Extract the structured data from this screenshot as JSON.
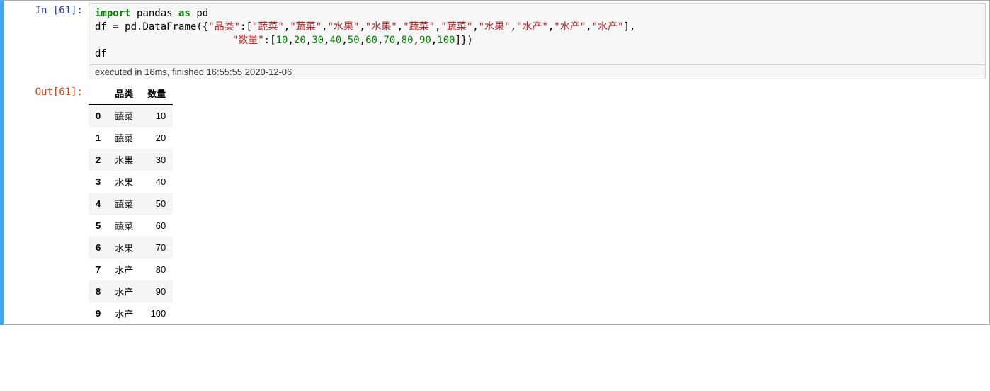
{
  "cell": {
    "in_prompt": "In  [61]:",
    "out_prompt": "Out[61]:",
    "exec_status": "executed in 16ms, finished 16:55:55 2020-12-06",
    "code": {
      "kw_import": "import",
      "mod_pandas": "pandas",
      "kw_as": "as",
      "mod_pd": "pd",
      "var_df": "df",
      "eq": " = ",
      "pd_call": "pd.DataFrame({",
      "key1": "\"品类\"",
      "colon1": ":[",
      "vals1_items": [
        "\"蔬菜\"",
        "\"蔬菜\"",
        "\"水果\"",
        "\"水果\"",
        "\"蔬菜\"",
        "\"蔬菜\"",
        "\"水果\"",
        "\"水产\"",
        "\"水产\"",
        "\"水产\""
      ],
      "close1": "],",
      "indent2": "                       ",
      "key2": "\"数量\"",
      "colon2": ":[",
      "vals2_items": [
        "10",
        "20",
        "30",
        "40",
        "50",
        "60",
        "70",
        "80",
        "90",
        "100"
      ],
      "close2": "]})",
      "last_line": "df"
    }
  },
  "table": {
    "columns": [
      "品类",
      "数量"
    ],
    "rows": [
      {
        "idx": "0",
        "c0": "蔬菜",
        "c1": "10"
      },
      {
        "idx": "1",
        "c0": "蔬菜",
        "c1": "20"
      },
      {
        "idx": "2",
        "c0": "水果",
        "c1": "30"
      },
      {
        "idx": "3",
        "c0": "水果",
        "c1": "40"
      },
      {
        "idx": "4",
        "c0": "蔬菜",
        "c1": "50"
      },
      {
        "idx": "5",
        "c0": "蔬菜",
        "c1": "60"
      },
      {
        "idx": "6",
        "c0": "水果",
        "c1": "70"
      },
      {
        "idx": "7",
        "c0": "水产",
        "c1": "80"
      },
      {
        "idx": "8",
        "c0": "水产",
        "c1": "90"
      },
      {
        "idx": "9",
        "c0": "水产",
        "c1": "100"
      }
    ]
  }
}
